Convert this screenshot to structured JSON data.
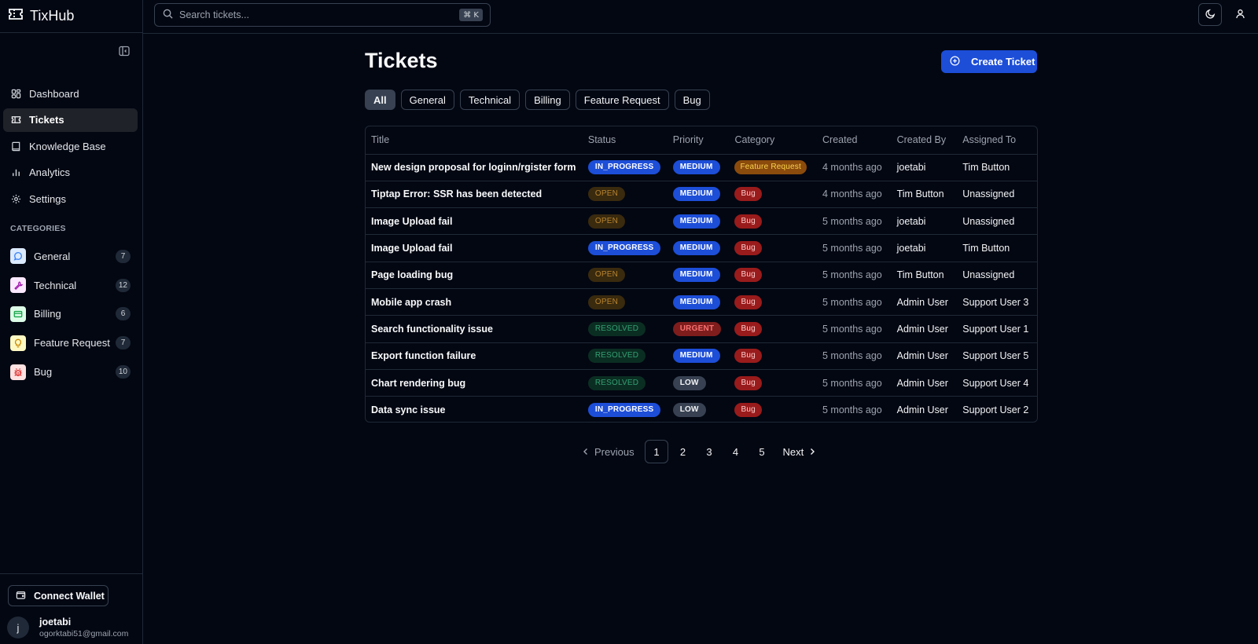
{
  "app": {
    "name": "TixHub"
  },
  "sidebar": {
    "nav": [
      {
        "label": "Dashboard",
        "icon": "dashboard-icon",
        "active": false
      },
      {
        "label": "Tickets",
        "icon": "ticket-icon",
        "active": true
      },
      {
        "label": "Knowledge Base",
        "icon": "book-icon",
        "active": false
      },
      {
        "label": "Analytics",
        "icon": "bar-chart-icon",
        "active": false
      },
      {
        "label": "Settings",
        "icon": "gear-icon",
        "active": false
      }
    ],
    "categories_heading": "CATEGORIES",
    "categories": [
      {
        "label": "General",
        "count": "7",
        "icon": "message-circle-icon",
        "color": "#3b82f6",
        "bg": "#dbeafe"
      },
      {
        "label": "Technical",
        "count": "12",
        "icon": "wrench-icon",
        "color": "#a21caf",
        "bg": "#fae8ff"
      },
      {
        "label": "Billing",
        "count": "6",
        "icon": "credit-card-icon",
        "color": "#16a34a",
        "bg": "#dcfce7"
      },
      {
        "label": "Feature Request",
        "count": "7",
        "icon": "lightbulb-icon",
        "color": "#ca8a04",
        "bg": "#fef9c3"
      },
      {
        "label": "Bug",
        "count": "10",
        "icon": "bug-icon",
        "color": "#dc2626",
        "bg": "#fee2e2"
      }
    ],
    "wallet_label": "Connect Wallet",
    "user": {
      "initial": "j",
      "name": "joetabi",
      "email": "ogorktabi51@gmail.com"
    }
  },
  "topbar": {
    "search_placeholder": "Search tickets...",
    "shortcut": "⌘ K"
  },
  "main": {
    "title": "Tickets",
    "create_label": "Create Ticket",
    "filters": [
      {
        "label": "All",
        "active": true
      },
      {
        "label": "General",
        "active": false
      },
      {
        "label": "Technical",
        "active": false
      },
      {
        "label": "Billing",
        "active": false
      },
      {
        "label": "Feature Request",
        "active": false
      },
      {
        "label": "Bug",
        "active": false
      }
    ],
    "columns": [
      "Title",
      "Status",
      "Priority",
      "Category",
      "Created",
      "Created By",
      "Assigned To"
    ],
    "rows": [
      {
        "title": "New design proposal for loginn/rgister form",
        "status": "IN_PROGRESS",
        "priority": "MEDIUM",
        "category": "Feature Request",
        "created": "4 months ago",
        "created_by": "joetabi",
        "assigned_to": "Tim Button"
      },
      {
        "title": "Tiptap Error: SSR has been detected",
        "status": "OPEN",
        "priority": "MEDIUM",
        "category": "Bug",
        "created": "4 months ago",
        "created_by": "Tim Button",
        "assigned_to": "Unassigned"
      },
      {
        "title": "Image Upload fail",
        "status": "OPEN",
        "priority": "MEDIUM",
        "category": "Bug",
        "created": "5 months ago",
        "created_by": "joetabi",
        "assigned_to": "Unassigned"
      },
      {
        "title": "Image Upload fail",
        "status": "IN_PROGRESS",
        "priority": "MEDIUM",
        "category": "Bug",
        "created": "5 months ago",
        "created_by": "joetabi",
        "assigned_to": "Tim Button"
      },
      {
        "title": "Page loading bug",
        "status": "OPEN",
        "priority": "MEDIUM",
        "category": "Bug",
        "created": "5 months ago",
        "created_by": "Tim Button",
        "assigned_to": "Unassigned"
      },
      {
        "title": "Mobile app crash",
        "status": "OPEN",
        "priority": "MEDIUM",
        "category": "Bug",
        "created": "5 months ago",
        "created_by": "Admin User",
        "assigned_to": "Support User 3"
      },
      {
        "title": "Search functionality issue",
        "status": "RESOLVED",
        "priority": "URGENT",
        "category": "Bug",
        "created": "5 months ago",
        "created_by": "Admin User",
        "assigned_to": "Support User 1"
      },
      {
        "title": "Export function failure",
        "status": "RESOLVED",
        "priority": "MEDIUM",
        "category": "Bug",
        "created": "5 months ago",
        "created_by": "Admin User",
        "assigned_to": "Support User 5"
      },
      {
        "title": "Chart rendering bug",
        "status": "RESOLVED",
        "priority": "LOW",
        "category": "Bug",
        "created": "5 months ago",
        "created_by": "Admin User",
        "assigned_to": "Support User 4"
      },
      {
        "title": "Data sync issue",
        "status": "IN_PROGRESS",
        "priority": "LOW",
        "category": "Bug",
        "created": "5 months ago",
        "created_by": "Admin User",
        "assigned_to": "Support User 2"
      }
    ],
    "pagination": {
      "previous": "Previous",
      "next": "Next",
      "pages": [
        "1",
        "2",
        "3",
        "4",
        "5"
      ],
      "current": "1"
    }
  },
  "colors": {
    "background": "#030712",
    "accent": "#1d4ed8",
    "border": "#1f2937"
  }
}
